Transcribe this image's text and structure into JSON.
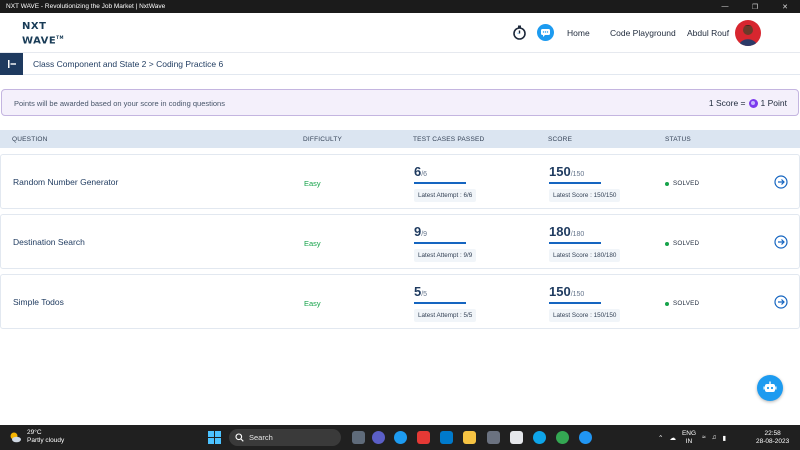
{
  "window": {
    "title": "NXT WAVE - Revolutionizing the Job Market | NxtWave",
    "controls": [
      "—",
      "❐",
      "✕"
    ]
  },
  "header": {
    "logo_line1": "NXT",
    "logo_line2": "WAVE",
    "logo_tm": "TM",
    "nav": {
      "home": "Home",
      "code_playground": "Code Playground",
      "user": "Abdul Rouf"
    }
  },
  "breadcrumb": "Class Component and State 2 > Coding Practice 6",
  "banner": {
    "message": "Points will be awarded based on your score in coding questions",
    "rate_left": "1 Score =",
    "rate_right": "1 Point"
  },
  "table": {
    "columns": [
      "QUESTION",
      "DIFFICULTY",
      "TEST CASES PASSED",
      "SCORE",
      "STATUS"
    ],
    "rows": [
      {
        "question": "Random Number Generator",
        "difficulty": "Easy",
        "passed": "6",
        "total": "/6",
        "attempt": "Latest Attempt : 6/6",
        "score": "150",
        "score_total": "/150",
        "latest_score": "Latest Score : 150/150",
        "status": "SOLVED"
      },
      {
        "question": "Destination Search",
        "difficulty": "Easy",
        "passed": "9",
        "total": "/9",
        "attempt": "Latest Attempt : 9/9",
        "score": "180",
        "score_total": "/180",
        "latest_score": "Latest Score : 180/180",
        "status": "SOLVED"
      },
      {
        "question": "Simple Todos",
        "difficulty": "Easy",
        "passed": "5",
        "total": "/5",
        "attempt": "Latest Attempt : 5/5",
        "score": "150",
        "score_total": "/150",
        "latest_score": "Latest Score : 150/150",
        "status": "SOLVED"
      }
    ]
  },
  "taskbar": {
    "weather_temp": "29°C",
    "weather_desc": "Partly cloudy",
    "search_label": "Search",
    "lang_line1": "ENG",
    "lang_line2": "IN",
    "time": "22:58",
    "date": "28-08-2023"
  },
  "colors": {
    "brand_navy": "#1e3a5f",
    "accent_blue": "#1565c0",
    "success_green": "#16a34a",
    "banner_bg": "#f4f0fb"
  }
}
